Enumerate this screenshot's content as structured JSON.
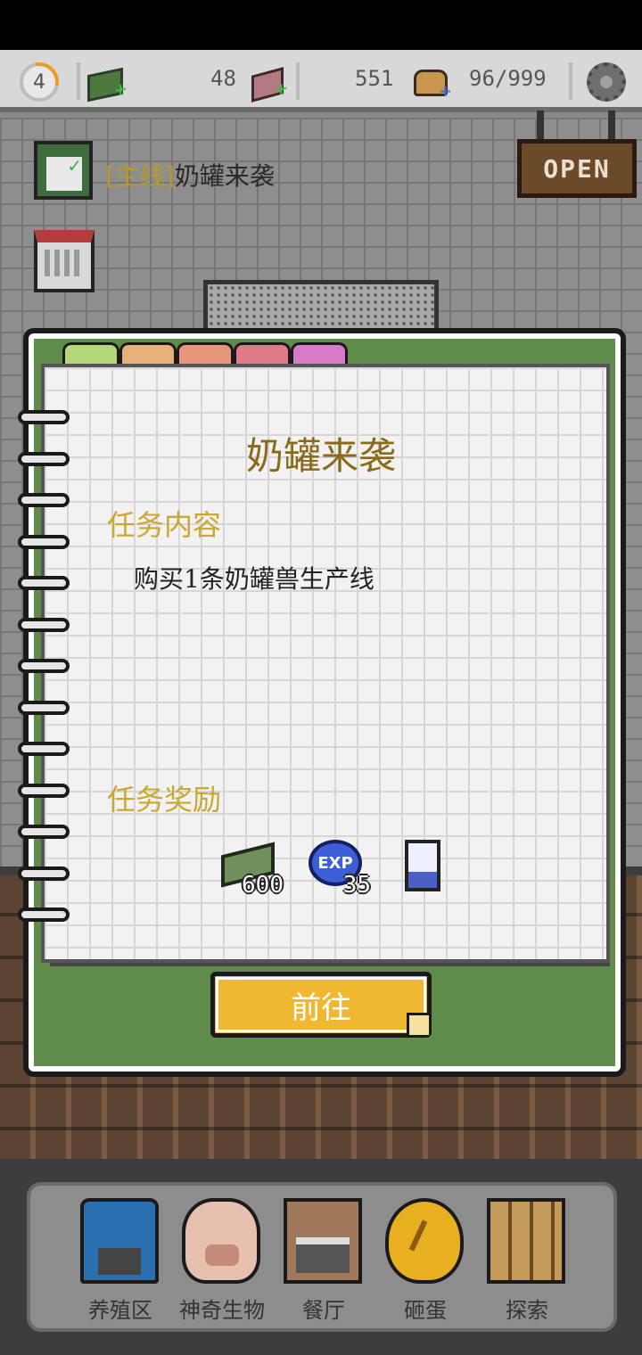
{
  "hud": {
    "level": "4",
    "bricks": "48",
    "bread": "551",
    "capacity": "96/999"
  },
  "quest": {
    "tag": "[主线]",
    "name": "奶罐来袭"
  },
  "sign": {
    "text": "OPEN"
  },
  "tab_colors": [
    "#b6d67a",
    "#e6b07a",
    "#e6967a",
    "#e07a8a",
    "#d87ac8"
  ],
  "notebook": {
    "title": "奶罐来袭",
    "content_label": "任务内容",
    "content_text": "购买1条奶罐兽生产线",
    "reward_label": "任务奖励",
    "rewards": [
      {
        "icon": "cash-icon",
        "value": "600"
      },
      {
        "icon": "exp-icon",
        "value": "35",
        "badge": "EXP"
      },
      {
        "icon": "milk-can-icon",
        "value": ""
      }
    ],
    "go_button": "前往"
  },
  "nav": [
    {
      "label": "养殖区",
      "icon": "farm-icon"
    },
    {
      "label": "神奇生物",
      "icon": "creature-icon"
    },
    {
      "label": "餐厅",
      "icon": "restaurant-icon"
    },
    {
      "label": "砸蛋",
      "icon": "egg-icon"
    },
    {
      "label": "探索",
      "icon": "map-icon"
    }
  ]
}
